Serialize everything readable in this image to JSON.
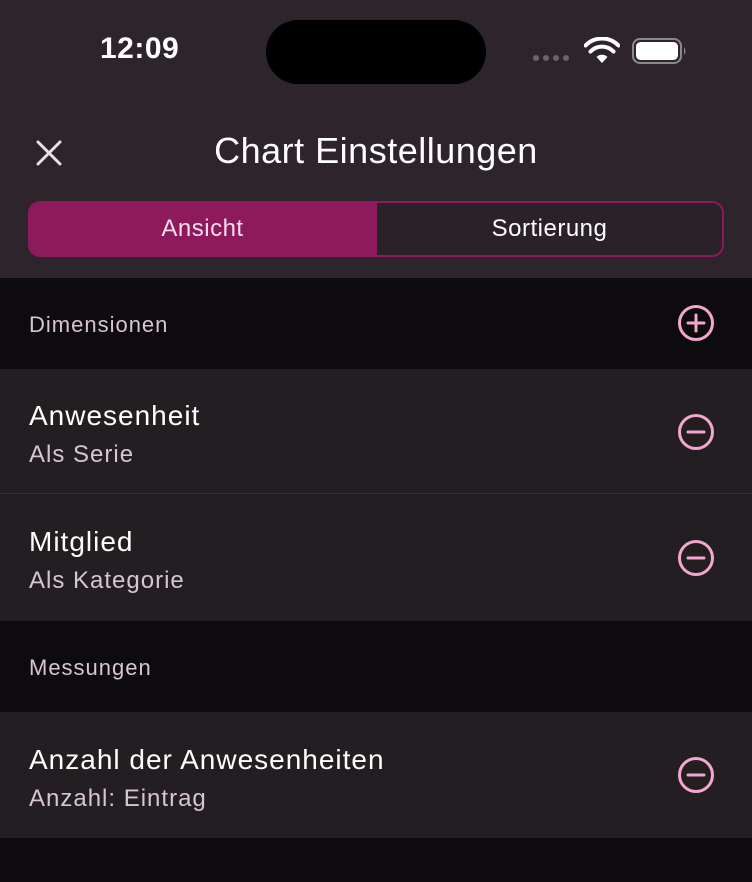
{
  "status_bar": {
    "time": "12:09",
    "icons": [
      "signal-icon",
      "wifi-icon",
      "battery-icon"
    ]
  },
  "header": {
    "title": "Chart Einstellungen",
    "close_icon": "close-icon"
  },
  "tabs": [
    {
      "label": "Ansicht",
      "selected": true
    },
    {
      "label": "Sortierung",
      "selected": false
    }
  ],
  "dimensions": {
    "header": "Dimensionen",
    "action_icon": "plus-circle-icon",
    "items": [
      {
        "title": "Anwesenheit",
        "subtitle": "Als Serie",
        "action_icon": "minus-circle-icon"
      },
      {
        "title": "Mitglied",
        "subtitle": "Als Kategorie",
        "action_icon": "minus-circle-icon"
      }
    ]
  },
  "measurements": {
    "header": "Messungen",
    "items": [
      {
        "title": "Anzahl der Anwesenheiten",
        "subtitle": "Anzahl: Eintrag",
        "action_icon": "minus-circle-icon"
      }
    ]
  },
  "colors": {
    "accent": "#8c1a5d",
    "icon_pink": "#f4a6cf",
    "header_bg": "#2d242c",
    "row_bg": "#221e22",
    "section_bg": "#0e0b0e"
  }
}
